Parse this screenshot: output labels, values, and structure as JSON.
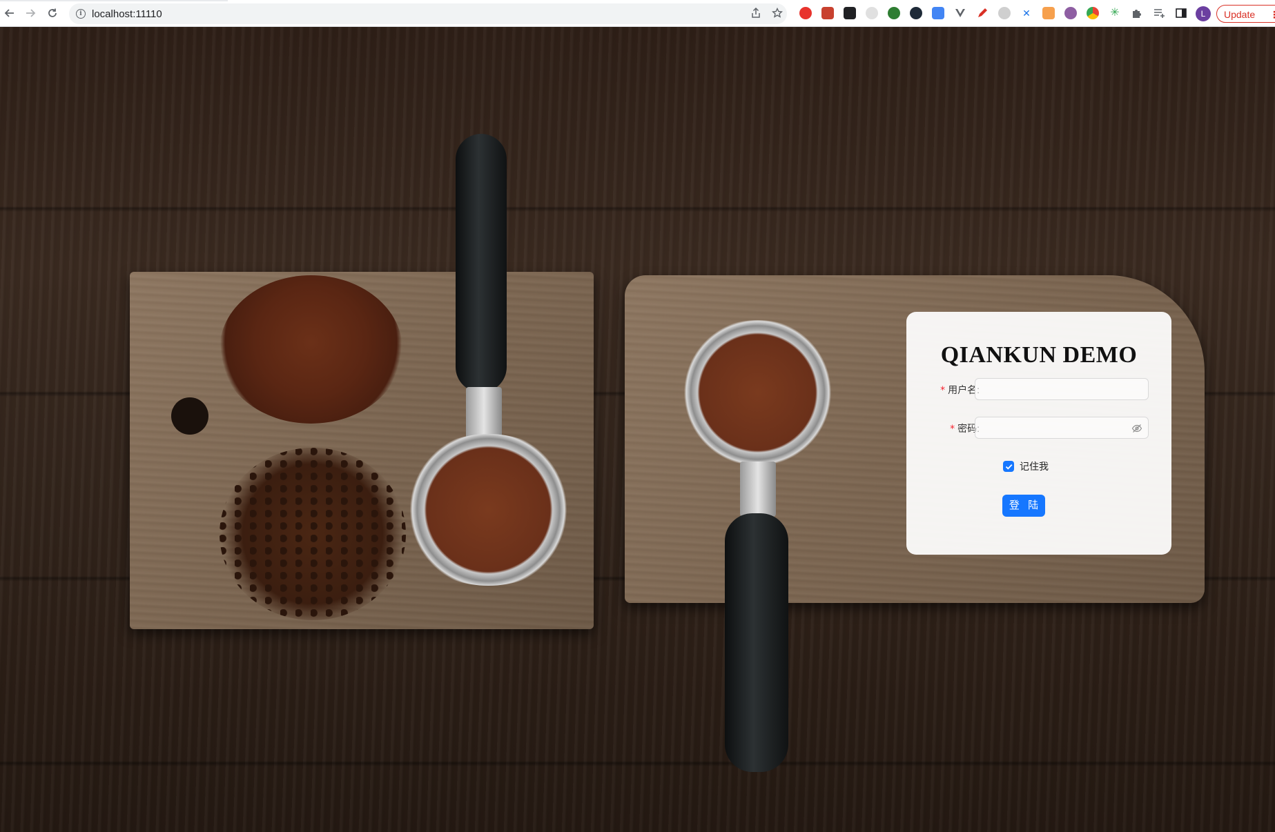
{
  "browser": {
    "url": "localhost:11110",
    "update_label": "Update",
    "profile_initial": "L"
  },
  "extensions": [
    {
      "name": "opera-extension-icon",
      "color": "#e8332d"
    },
    {
      "name": "image-extension-icon",
      "color": "#c8412f"
    },
    {
      "name": "glasses-extension-icon",
      "color": "#202124"
    },
    {
      "name": "clock-extension-icon",
      "color": "#bdbdbd"
    },
    {
      "name": "search-extension-icon",
      "color": "#2e7d32"
    },
    {
      "name": "react-extension-icon",
      "color": "#1e2a38"
    },
    {
      "name": "translate-extension-icon",
      "color": "#4285f4"
    },
    {
      "name": "vue-extension-icon",
      "color": "#5f6368"
    },
    {
      "name": "pen-extension-icon",
      "color": "#d93025"
    },
    {
      "name": "cat-extension-icon",
      "color": "#9e9e9e"
    },
    {
      "name": "x-extension-icon",
      "color": "#1a73e8"
    },
    {
      "name": "orange-extension-icon",
      "color": "#f6a04d"
    },
    {
      "name": "purple-extension-icon",
      "color": "#8e5ea2"
    },
    {
      "name": "chrome-extension-icon",
      "color": "#34a853"
    },
    {
      "name": "green-extension-icon",
      "color": "#34a853"
    }
  ],
  "login": {
    "title": "QIANKUN DEMO",
    "username_label": "用户名:",
    "password_label": "密码:",
    "remember_label": "记住我",
    "remember_checked": true,
    "submit_label": "登 陆",
    "accent_color": "#1677ff"
  }
}
